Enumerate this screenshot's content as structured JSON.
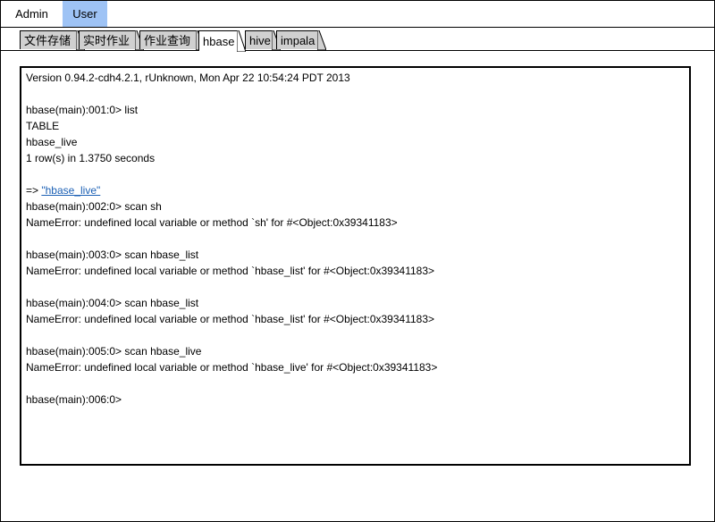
{
  "top_tabs": [
    {
      "label": "Admin"
    },
    {
      "label": "User"
    }
  ],
  "sub_tabs": [
    {
      "label": "文件存储"
    },
    {
      "label": "实时作业"
    },
    {
      "label": "作业查询"
    },
    {
      "label": "hbase"
    },
    {
      "label": "hive"
    },
    {
      "label": "impala"
    }
  ],
  "active_sub_tab": "hbase",
  "console": {
    "lines": [
      "Version 0.94.2-cdh4.2.1, rUnknown, Mon Apr 22 10:54:24 PDT 2013",
      "",
      "hbase(main):001:0> list",
      "TABLE",
      "hbase_live",
      "1 row(s) in 1.3750 seconds",
      "",
      "=> ",
      "hbase(main):002:0> scan sh",
      "NameError: undefined local variable or method `sh' for #<Object:0x39341183>",
      "",
      "hbase(main):003:0> scan hbase_list",
      "NameError: undefined local variable or method `hbase_list' for #<Object:0x39341183>",
      "",
      "hbase(main):004:0> scan hbase_list",
      "NameError: undefined local variable or method `hbase_list' for #<Object:0x39341183>",
      "",
      "hbase(main):005:0> scan hbase_live",
      "NameError: undefined local variable or method `hbase_live' for #<Object:0x39341183>",
      "",
      "hbase(main):006:0>"
    ],
    "result_link": "\"hbase_live\""
  },
  "colors": {
    "active_top_tab": "#9ec3f5",
    "inactive_sub_tab": "#d0d0d0",
    "link": "#1a5fb4"
  }
}
